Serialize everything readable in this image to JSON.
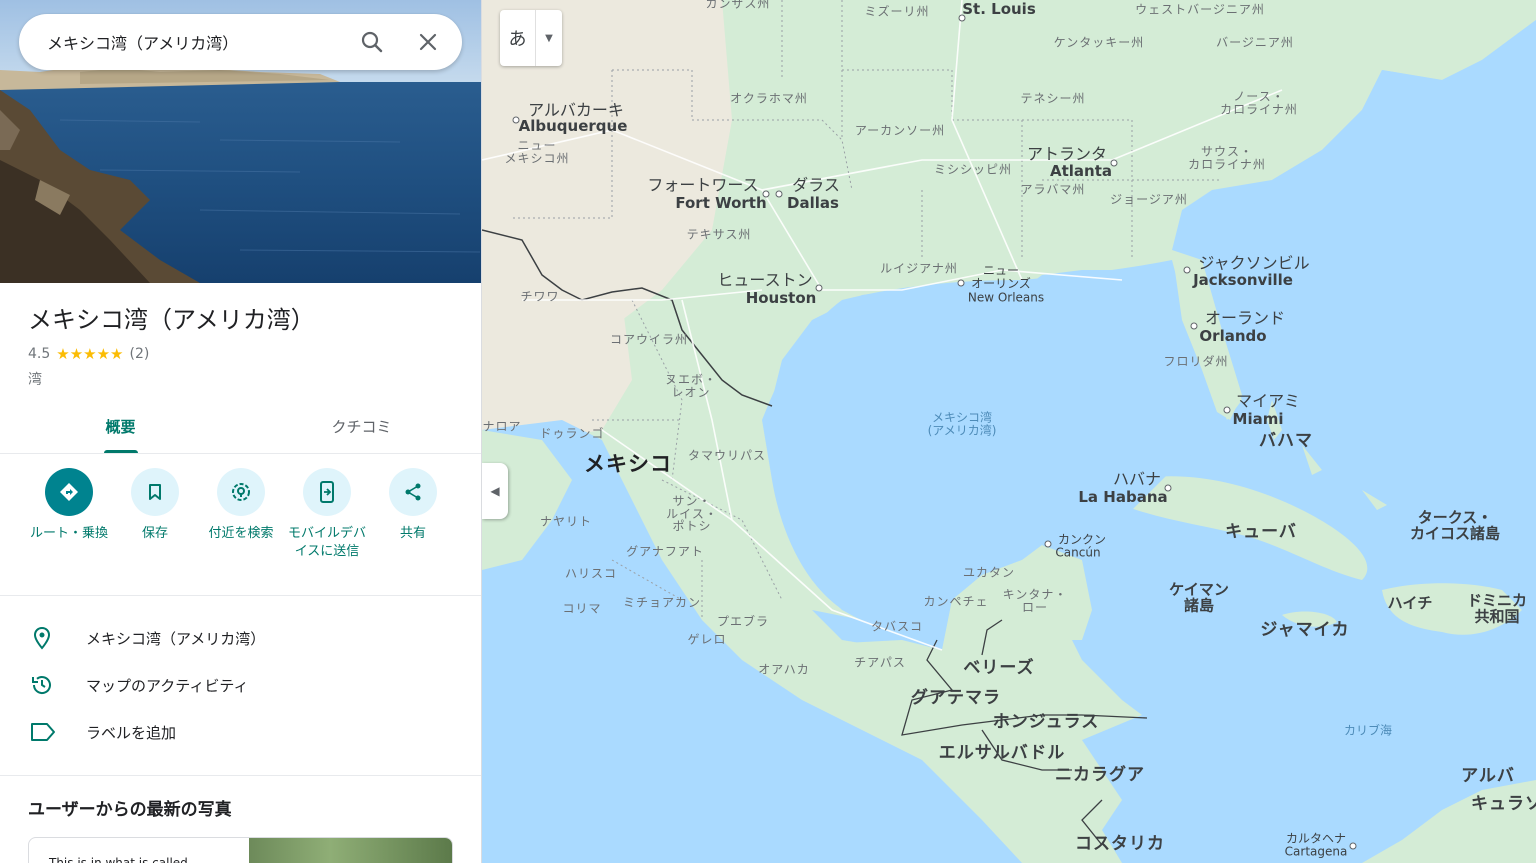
{
  "search": {
    "query": "メキシコ湾（アメリカ湾）"
  },
  "place": {
    "title": "メキシコ湾（アメリカ湾）",
    "rating": "4.5",
    "stars": "★★★★★",
    "review_count": "(2)",
    "category": "湾"
  },
  "tabs": [
    {
      "label": "概要",
      "active": true
    },
    {
      "label": "クチコミ",
      "active": false
    }
  ],
  "actions": [
    {
      "label": "ルート・乗換",
      "icon": "directions-icon"
    },
    {
      "label": "保存",
      "icon": "bookmark-icon"
    },
    {
      "label": "付近を検索",
      "icon": "nearby-icon"
    },
    {
      "label": "モバイルデバイスに送信",
      "icon": "send-to-phone-icon"
    },
    {
      "label": "共有",
      "icon": "share-icon"
    }
  ],
  "info_rows": [
    {
      "text": "メキシコ湾（アメリカ湾）",
      "icon": "location-pin-icon"
    },
    {
      "text": "マップのアクティビティ",
      "icon": "history-icon"
    },
    {
      "text": "ラベルを追加",
      "icon": "label-icon"
    }
  ],
  "photos": {
    "title": "ユーザーからの最新の写真",
    "card_text": "This is in what is called"
  },
  "map": {
    "lang_button": "あ",
    "labels": {
      "kansas": "カンザス州",
      "missouri": "ミズーリ州",
      "st_louis": "St. Louis",
      "west_virginia": "ウェストバージニア州",
      "kentucky": "ケンタッキー州",
      "virginia": "バージニア州",
      "albuquerque_jp": "アルバカーキ",
      "albuquerque_en": "Albuquerque",
      "oklahoma": "オクラホマ州",
      "new_mexico": "ニュー\nメキシコ州",
      "tennessee": "テネシー州",
      "north_carolina": "ノース・\nカロライナ州",
      "arkansas": "アーカンソー州",
      "atlanta_jp": "アトランタ",
      "atlanta_en": "Atlanta",
      "south_carolina": "サウス・\nカロライナ州",
      "mississippi": "ミシシッピ州",
      "alabama": "アラバマ州",
      "fortworth_jp": "フォートワース",
      "fortworth_en": "Fort Worth",
      "dallas_jp": "ダラス",
      "dallas_en": "Dallas",
      "georgia": "ジョージア州",
      "texas": "テキサス州",
      "louisiana": "ルイジアナ州",
      "neworleans_jp": "ニュー\nオーリンズ",
      "neworleans_en": "New Orleans",
      "jacksonville_jp": "ジャクソンビル",
      "jacksonville_en": "Jacksonville",
      "houston_jp": "ヒューストン",
      "houston_en": "Houston",
      "chihuahua": "チワワ",
      "orlando_jp": "オーランド",
      "orlando_en": "Orlando",
      "coahuila": "コアウイラ州",
      "florida": "フロリダ州",
      "nuevo_leon": "ヌエボ・\nレオン",
      "miami_jp": "マイアミ",
      "miami_en": "Miami",
      "gulf": "メキシコ湾\n(アメリカ湾)",
      "bahamas": "バハマ",
      "sinaloa": "ナロア",
      "durango": "ドゥランゴ",
      "tamaulipas": "タマウリパス",
      "mexico": "メキシコ",
      "havana_jp": "ハバナ",
      "havana_en": "La Habana",
      "turks": "タークス・\nカイコス諸島",
      "slp": "サン・\nルイス・\nポトシ",
      "nayarit": "ナヤリト",
      "cuba": "キューバ",
      "cancun_jp": "カンクン",
      "cancun_en": "Cancún",
      "aguascalientes": "グアナフアト",
      "jalisco": "ハリスコ",
      "yucatan": "ユカタン",
      "cayman": "ケイマン\n諸島",
      "haiti": "ハイチ",
      "dominican": "ドミニカ\n共和国",
      "colima": "コリマ",
      "michoacan": "ミチョアカン",
      "campeche": "カンペチェ",
      "qroo": "キンタナ・\nロー",
      "jamaica": "ジャマイカ",
      "puebla": "プエブラ",
      "tabasco": "タバスコ",
      "guerrero": "ゲレロ",
      "belize": "ベリーズ",
      "oaxaca": "オアハカ",
      "chiapas": "チアパス",
      "guatemala": "グアテマラ",
      "honduras": "ホンジュラス",
      "caribbean": "カリブ海",
      "aruba": "アルバ",
      "el_salvador": "エルサルバドル",
      "curacao": "キュラソ",
      "nicaragua": "ニカラグア",
      "costa_rica": "コスタリカ",
      "cartagena_jp": "カルタヘナ",
      "cartagena_en": "Cartagena"
    }
  }
}
